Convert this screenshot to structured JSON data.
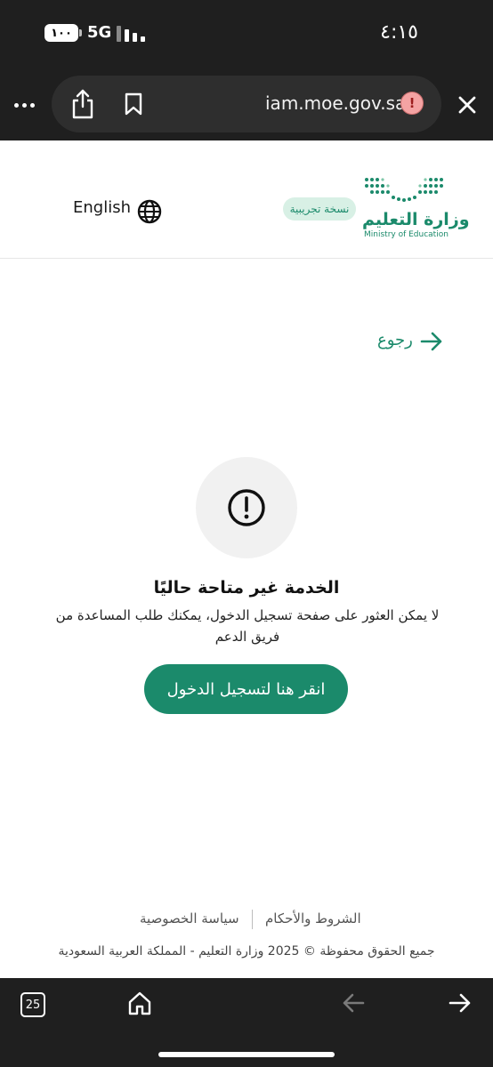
{
  "status_bar": {
    "battery": "١٠٠",
    "network": "5G",
    "time": "٤:١٥"
  },
  "browser": {
    "url": "iam.moe.gov.sa",
    "icons": [
      "menu-dots-icon",
      "share-icon",
      "bookmark-icon",
      "security-warning-icon",
      "close-icon"
    ]
  },
  "header": {
    "language_label": "English",
    "beta_badge": "نسخة تجريبية",
    "logo_arabic": "وزارة التعليم",
    "logo_english": "Ministry of Education"
  },
  "main": {
    "back_label": "رجوع",
    "title": "الخدمة غير متاحة حاليًا",
    "message": "لا يمكن العثور على صفحة تسجيل الدخول، يمكنك طلب المساعدة من فريق الدعم",
    "login_button": "انقر هنا لتسجيل الدخول"
  },
  "footer": {
    "terms": "الشروط والأحكام",
    "privacy": "سياسة الخصوصية",
    "copyright": "جميع الحقوق محفوظة © 2025 وزارة التعليم - المملكة العربية السعودية"
  },
  "bottom_bar": {
    "tab_count": "25"
  },
  "colors": {
    "brand_green": "#1b8a6b",
    "badge_bg": "#d8f0e5",
    "chrome_bg": "#1f1f1f"
  }
}
